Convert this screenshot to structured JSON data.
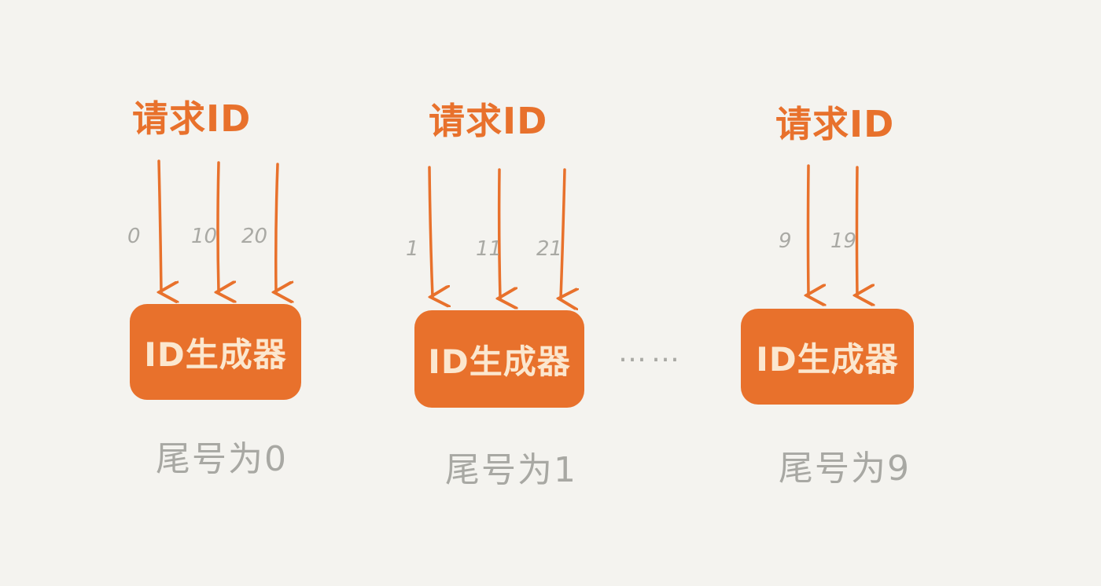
{
  "request_label": "请求ID",
  "generator_label": "ID生成器",
  "ellipsis": "……",
  "colors": {
    "accent": "#e8712c",
    "box_text": "#fbe7cf",
    "gray": "#a9a9a4",
    "background": "#f4f3ef"
  },
  "groups": [
    {
      "request": "请求ID",
      "generator": "ID生成器",
      "tail": "尾号为0",
      "ids": [
        "0",
        "10",
        "20"
      ]
    },
    {
      "request": "请求ID",
      "generator": "ID生成器",
      "tail": "尾号为1",
      "ids": [
        "1",
        "11",
        "21"
      ]
    },
    {
      "request": "请求ID",
      "generator": "ID生成器",
      "tail": "尾号为9",
      "ids": [
        "9",
        "19"
      ]
    }
  ]
}
